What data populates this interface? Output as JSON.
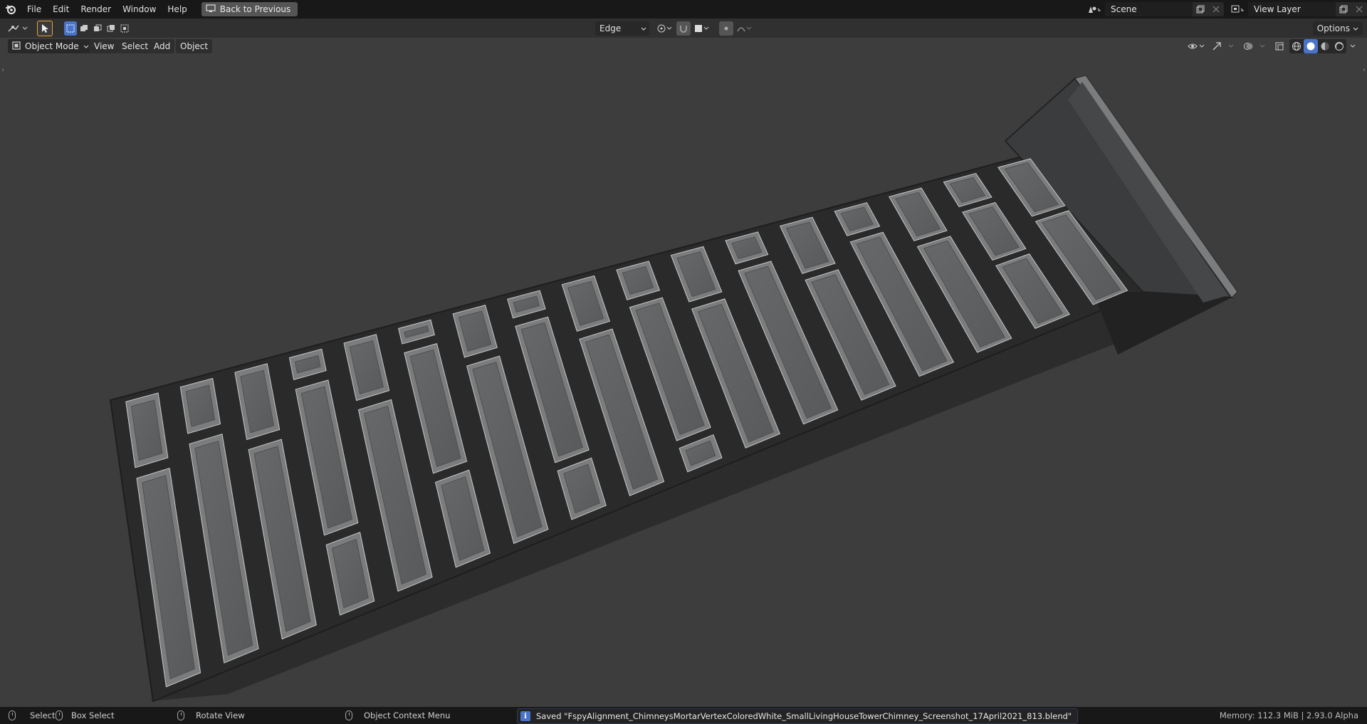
{
  "menu": {
    "items": [
      "File",
      "Edit",
      "Render",
      "Window",
      "Help"
    ],
    "back_button": "Back to Previous"
  },
  "scene": {
    "label": "Scene",
    "view_layer": "View Layer"
  },
  "toolbar": {
    "pivot_select": "Edge",
    "options_label": "Options"
  },
  "viewport_header": {
    "mode": "Object Mode",
    "menus": [
      "View",
      "Select",
      "Add",
      "Object"
    ]
  },
  "status": {
    "select": "Select",
    "box_select": "Box Select",
    "rotate_view": "Rotate View",
    "context_menu": "Object Context Menu",
    "report": "Saved \"FspyAlignment_ChimneysMortarVertexColoredWhite_SmallLivingHouseTowerChimney_Screenshot_17April2021_813.blend\"",
    "memory": "Memory: 112.3 MiB | 2.93.0 Alpha"
  },
  "colors": {
    "topbar": "#181818",
    "toolbar": "#303030",
    "viewport": "#3d3d3d",
    "brick": "#5e6061",
    "mortar": "#2a2a2a",
    "accent": "#4a74c9",
    "tool_active_border": "#e8a33a"
  },
  "icons": [
    "blender-logo-icon",
    "select-tool-icon",
    "info-icon"
  ]
}
